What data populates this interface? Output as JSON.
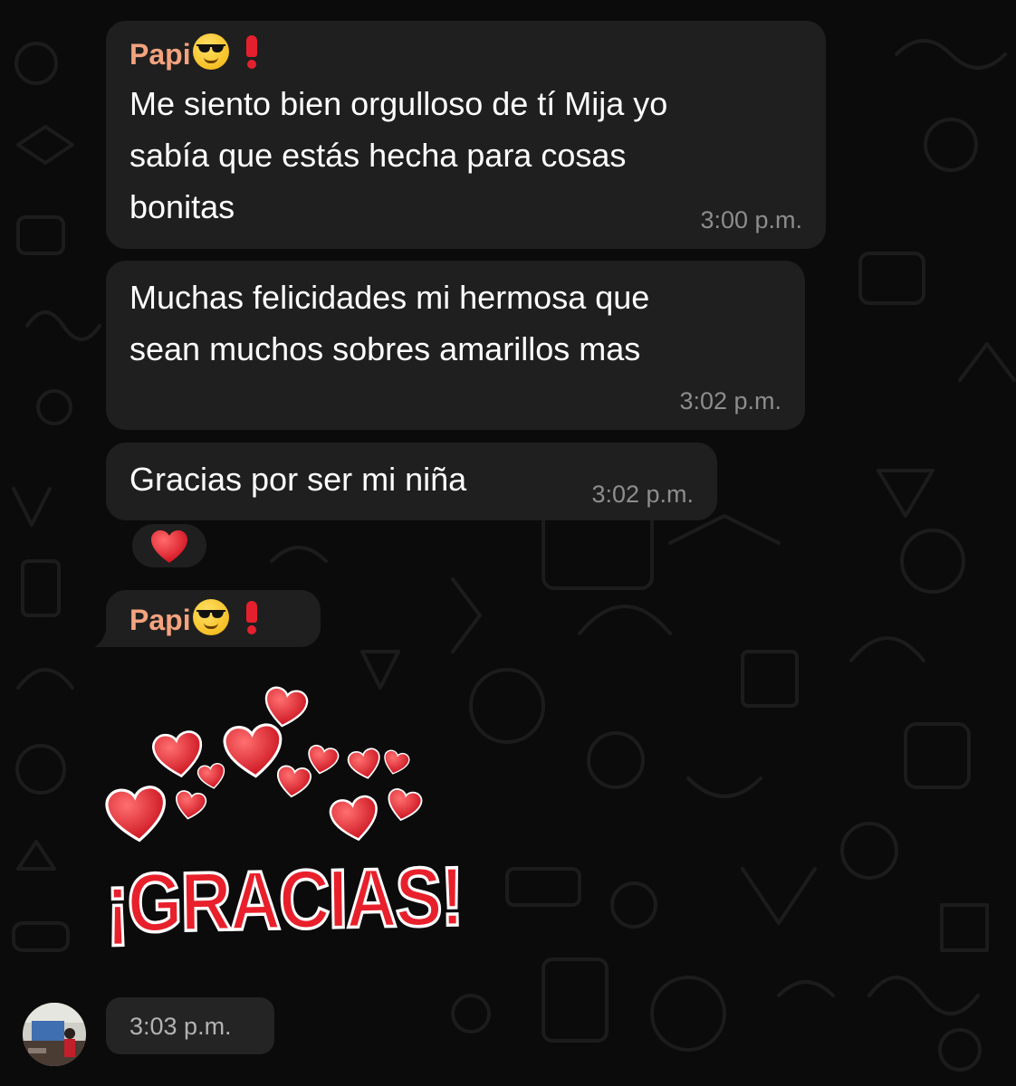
{
  "chat": {
    "messages": [
      {
        "sender": "Papi",
        "sender_emojis": [
          "smiling-face-with-sunglasses",
          "red-exclamation-mark"
        ],
        "lines": [
          "Me siento bien orgulloso de tí Mija yo",
          "sabía que estás hecha para cosas",
          "bonitas"
        ],
        "time": "3:00 p.m."
      },
      {
        "lines": [
          "Muchas felicidades mi hermosa que",
          "sean muchos sobres amarillos mas"
        ],
        "time": "3:02 p.m."
      },
      {
        "lines": [
          "Gracias por ser mi niña"
        ],
        "time": "3:02 p.m.",
        "reaction": "red-heart"
      },
      {
        "sender": "Papi",
        "sender_emojis": [
          "smiling-face-with-sunglasses",
          "red-exclamation-mark"
        ],
        "sticker": {
          "text": "¡GRACIAS!",
          "decoration": "red-hearts"
        },
        "time": "3:03 p.m."
      }
    ]
  },
  "colors": {
    "background": "#0b0b0b",
    "bubble": "#1f1f1f",
    "sender_name": "#f4a37f",
    "timestamp": "#8d8d8d",
    "heart": "#e8202b"
  }
}
